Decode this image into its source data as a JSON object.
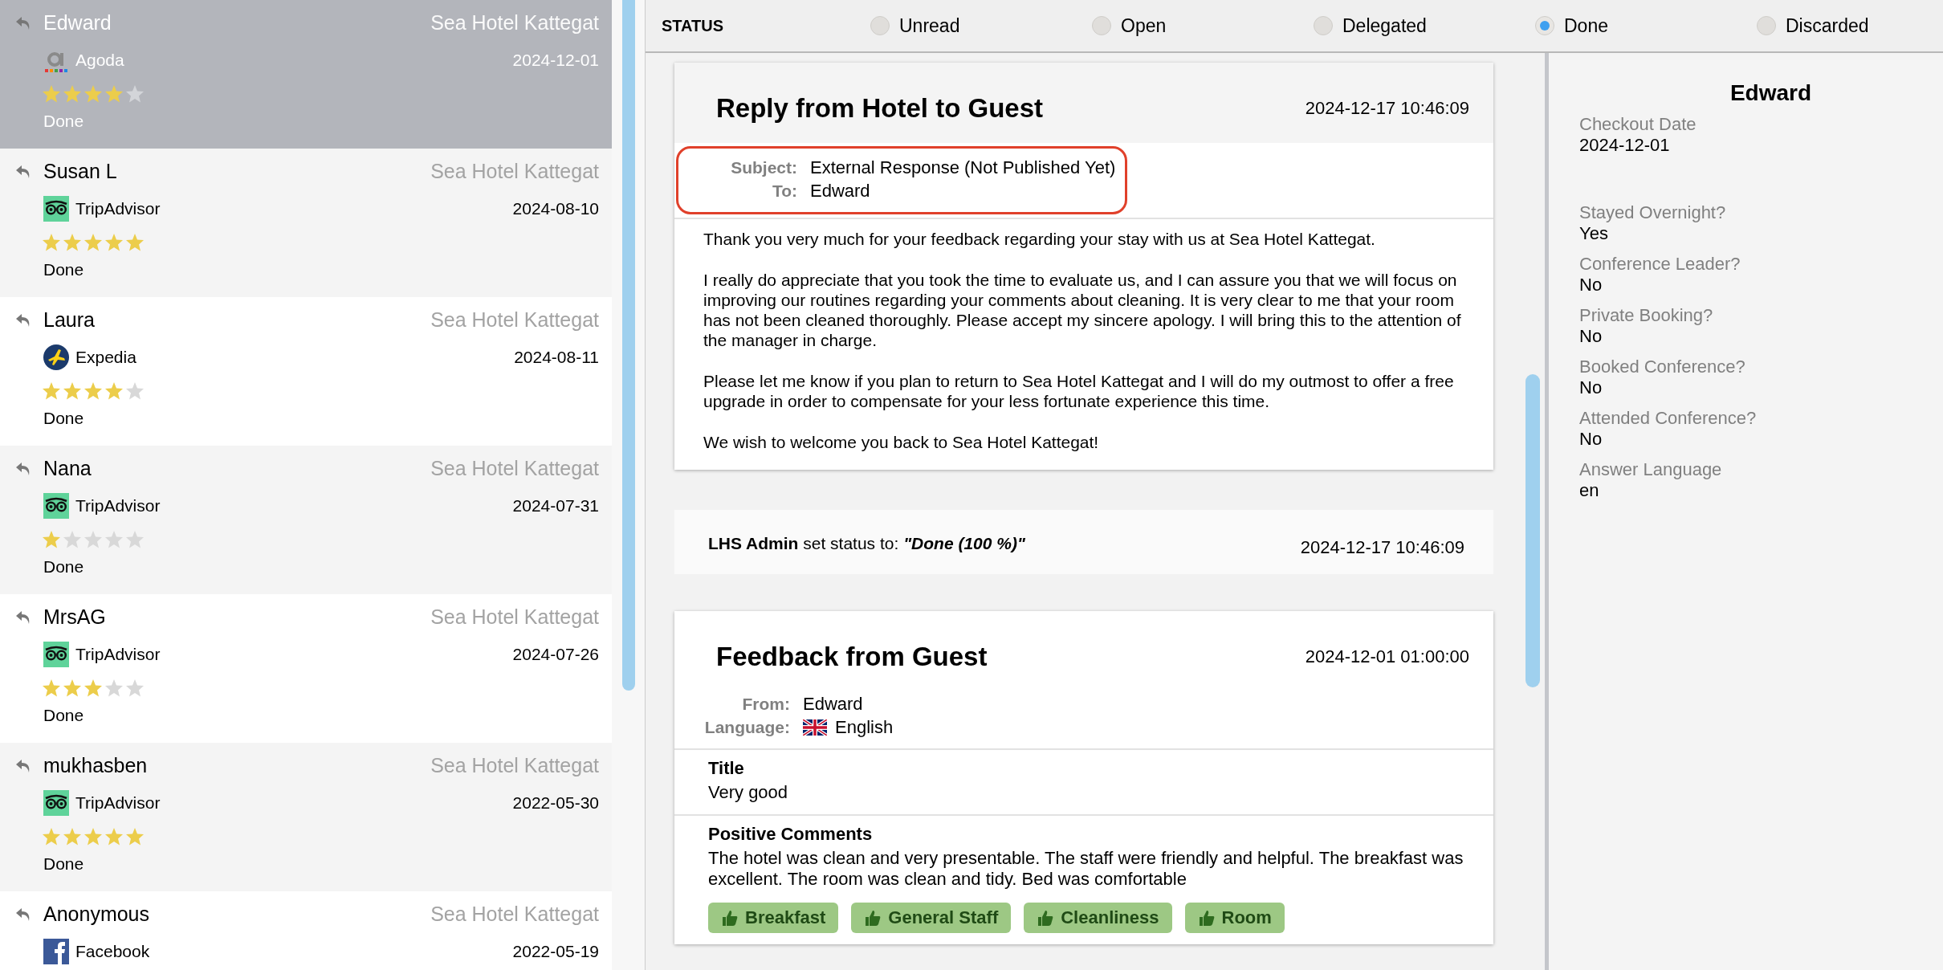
{
  "reviews": [
    {
      "name": "Edward",
      "hotel": "Sea Hotel Kattegat",
      "source": "Agoda",
      "kind": "agoda",
      "date": "2024-12-01",
      "stars": 4,
      "status": "Done",
      "selected": true
    },
    {
      "name": "Susan L",
      "hotel": "Sea Hotel Kattegat",
      "source": "TripAdvisor",
      "kind": "tripadvisor",
      "date": "2024-08-10",
      "stars": 5,
      "status": "Done",
      "selected": false
    },
    {
      "name": "Laura",
      "hotel": "Sea Hotel Kattegat",
      "source": "Expedia",
      "kind": "expedia",
      "date": "2024-08-11",
      "stars": 4,
      "status": "Done",
      "selected": false
    },
    {
      "name": "Nana",
      "hotel": "Sea Hotel Kattegat",
      "source": "TripAdvisor",
      "kind": "tripadvisor",
      "date": "2024-07-31",
      "stars": 1,
      "status": "Done",
      "selected": false
    },
    {
      "name": "MrsAG",
      "hotel": "Sea Hotel Kattegat",
      "source": "TripAdvisor",
      "kind": "tripadvisor",
      "date": "2024-07-26",
      "stars": 3,
      "status": "Done",
      "selected": false
    },
    {
      "name": "mukhasben",
      "hotel": "Sea Hotel Kattegat",
      "source": "TripAdvisor",
      "kind": "tripadvisor",
      "date": "2022-05-30",
      "stars": 5,
      "status": "Done",
      "selected": false
    },
    {
      "name": "Anonymous",
      "hotel": "Sea Hotel Kattegat",
      "source": "Facebook",
      "kind": "facebook",
      "date": "2022-05-19",
      "selected": false
    }
  ],
  "status_bar": {
    "label": "STATUS",
    "options": [
      {
        "label": "Unread",
        "selected": false
      },
      {
        "label": "Open",
        "selected": false
      },
      {
        "label": "Delegated",
        "selected": false
      },
      {
        "label": "Done",
        "selected": true
      },
      {
        "label": "Discarded",
        "selected": false
      }
    ]
  },
  "reply": {
    "title": "Reply from Hotel to Guest",
    "timestamp": "2024-12-17 10:46:09",
    "fields": [
      {
        "label": "Subject:",
        "value": "External Response (Not Published Yet)"
      },
      {
        "label": "To:",
        "value": "Edward"
      }
    ],
    "paragraphs": [
      "Thank you very much for your feedback regarding your stay with us at Sea Hotel Kattegat.",
      "I really do appreciate that you took the time to evaluate us, and I can assure you that we will focus on improving our routines regarding your comments about cleaning. It is very clear to me that your room has not been cleaned thoroughly. Please accept my sincere apology. I will bring this to the attention of the manager in charge.",
      "Please let me know if you plan to return to Sea Hotel Kattegat and I will do my outmost to offer a free upgrade in order to compensate for your less fortunate experience this time.",
      "We wish to welcome you back to Sea Hotel Kattegat!"
    ]
  },
  "status_change": {
    "text": "**LHS Admin** set status to:",
    "value": "\"Done (100 %)\"",
    "timestamp": "2024-12-17 10:46:09"
  },
  "feedback": {
    "title": "Feedback from Guest",
    "timestamp": "2024-12-01 01:00:00",
    "from_label": "From:",
    "from": "Edward",
    "language_label": "Language:",
    "language": "English",
    "sections": [
      {
        "heading": "Title",
        "text": "Very good"
      },
      {
        "heading": "Positive Comments",
        "text": "The hotel was clean and very presentable. The staff were friendly and helpful. The breakfast was excellent. The room was clean and tidy. Bed was comfortable"
      }
    ],
    "tags": [
      "Breakfast",
      "General Staff",
      "Cleanliness",
      "Room"
    ]
  },
  "guest": {
    "name": "Edward",
    "details": [
      {
        "label": "Checkout Date",
        "value": "2024-12-01"
      },
      {
        "label": "Stayed Overnight?",
        "value": "Yes"
      },
      {
        "label": "Conference Leader?",
        "value": "No"
      },
      {
        "label": "Private Booking?",
        "value": "No"
      },
      {
        "label": "Booked Conference?",
        "value": "No"
      },
      {
        "label": "Attended Conference?",
        "value": "No"
      },
      {
        "label": "Answer Language",
        "value": "en"
      }
    ]
  }
}
